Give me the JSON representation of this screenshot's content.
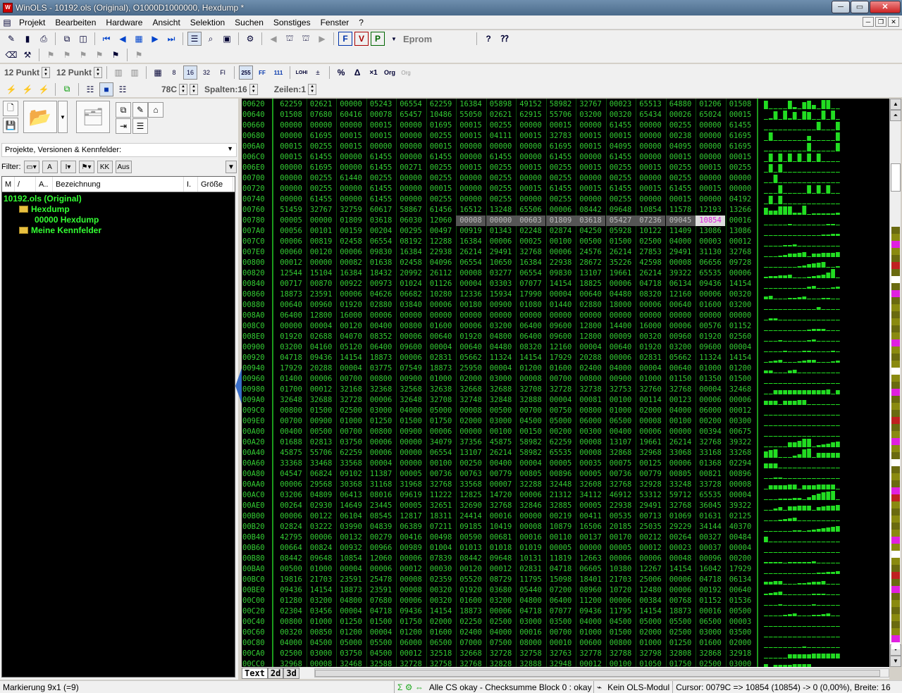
{
  "window": {
    "title": "WinOLS - 10192.ols (Original), O1000D1000000, Hexdump *",
    "controls": [
      "─",
      "▭",
      "✕"
    ]
  },
  "menu": [
    "Projekt",
    "Bearbeiten",
    "Hardware",
    "Ansicht",
    "Selektion",
    "Suchen",
    "Sonstiges",
    "Fenster",
    "?"
  ],
  "toolbar1": {
    "eprom_label": "Eprom"
  },
  "toolbar3": {
    "font_size_1": "12 Punkt",
    "font_size_2": "12 Punkt"
  },
  "toolbar4": {
    "offset": "78C",
    "columns": "Spalten:16",
    "rows": "Zeilen:1"
  },
  "left_panel": {
    "project_select": "Projekte, Versionen & Kennfelder:",
    "filter_label": "Filter:",
    "filter_aus": "Aus",
    "columns": [
      "M",
      "/",
      "A..",
      "Bezeichnung",
      "I.",
      "Größe"
    ],
    "tree": [
      {
        "text": "10192.ols (Original)",
        "indent": 0,
        "folder": false
      },
      {
        "text": "Hexdump",
        "indent": 1,
        "folder": true
      },
      {
        "text": "00000    Hexdump",
        "indent": 2,
        "folder": false
      },
      {
        "text": "Meine Kennfelder",
        "indent": 1,
        "folder": true
      }
    ]
  },
  "hexdump": {
    "addresses": [
      "00620",
      "00640",
      "00660",
      "00680",
      "006A0",
      "006C0",
      "006E0",
      "00700",
      "00720",
      "00740",
      "00760",
      "00780",
      "007A0",
      "007C0",
      "007E0",
      "00800",
      "00820",
      "00840",
      "00860",
      "00880",
      "008A0",
      "008C0",
      "008E0",
      "00900",
      "00920",
      "00940",
      "00960",
      "00980",
      "009A0",
      "009C0",
      "009E0",
      "00A00",
      "00A20",
      "00A40",
      "00A60",
      "00A80",
      "00AA0",
      "00AC0",
      "00AE0",
      "00B00",
      "00B20",
      "00B40",
      "00B60",
      "00B80",
      "00BA0",
      "00BC0",
      "00BE0",
      "00C00",
      "00C20",
      "00C40",
      "00C60",
      "00C80",
      "00CA0",
      "00CC0"
    ],
    "rows": [
      [
        "62259",
        "02621",
        "00000",
        "05243",
        "06554",
        "62259",
        "16384",
        "05898",
        "49152",
        "58982",
        "32767",
        "00023",
        "65513",
        "64880",
        "01206",
        "01508"
      ],
      [
        "01508",
        "07680",
        "60416",
        "00078",
        "65457",
        "10486",
        "55050",
        "02621",
        "62915",
        "55706",
        "03200",
        "00320",
        "65434",
        "00026",
        "65024",
        "00015"
      ],
      [
        "00000",
        "00000",
        "00000",
        "00015",
        "00000",
        "01695",
        "00015",
        "00255",
        "00000",
        "00015",
        "00000",
        "61455",
        "00000",
        "00255",
        "00000",
        "61455"
      ],
      [
        "00000",
        "61695",
        "00015",
        "00015",
        "00000",
        "00255",
        "00015",
        "04111",
        "00015",
        "32783",
        "00015",
        "00015",
        "00000",
        "00238",
        "00000",
        "61695"
      ],
      [
        "00015",
        "00255",
        "00015",
        "00000",
        "00000",
        "00015",
        "00000",
        "00000",
        "00000",
        "61695",
        "00015",
        "04095",
        "00000",
        "04095",
        "00000",
        "61695"
      ],
      [
        "00015",
        "61455",
        "00000",
        "61455",
        "00000",
        "61455",
        "00000",
        "61455",
        "00000",
        "61455",
        "00000",
        "61455",
        "00000",
        "00015",
        "00000",
        "00015"
      ],
      [
        "00000",
        "61695",
        "00000",
        "61455",
        "00271",
        "00255",
        "00015",
        "00255",
        "00015",
        "00255",
        "00015",
        "00255",
        "00015",
        "00255",
        "00015",
        "00255"
      ],
      [
        "00000",
        "00255",
        "61440",
        "00255",
        "00000",
        "00255",
        "00000",
        "00255",
        "00000",
        "00255",
        "00000",
        "00255",
        "00000",
        "00255",
        "00000",
        "00000"
      ],
      [
        "00000",
        "00255",
        "00000",
        "61455",
        "00000",
        "00015",
        "00000",
        "00255",
        "00015",
        "61455",
        "00015",
        "61455",
        "00015",
        "61455",
        "00015",
        "00000"
      ],
      [
        "00000",
        "61455",
        "00000",
        "61455",
        "00000",
        "00255",
        "00000",
        "00255",
        "00000",
        "00255",
        "00000",
        "00255",
        "00000",
        "00015",
        "00000",
        "04192"
      ],
      [
        "51459",
        "32767",
        "32759",
        "60617",
        "58867",
        "61456",
        "16512",
        "13248",
        "65506",
        "00006",
        "08442",
        "09648",
        "10854",
        "11578",
        "12193",
        "13266"
      ],
      [
        "00005",
        "00000",
        "01809",
        "03618",
        "06030",
        "12060",
        "00008",
        "00000",
        "00603",
        "01809",
        "03618",
        "05427",
        "07236",
        "09045",
        "10854",
        "00016"
      ],
      [
        "00056",
        "00101",
        "00159",
        "00204",
        "00295",
        "00497",
        "00919",
        "01343",
        "02248",
        "02874",
        "04250",
        "05928",
        "10122",
        "11409",
        "13086",
        "13086"
      ],
      [
        "00006",
        "00819",
        "02458",
        "06554",
        "08192",
        "12288",
        "16384",
        "00006",
        "00025",
        "00100",
        "00500",
        "01500",
        "02500",
        "04000",
        "00003",
        "00012"
      ],
      [
        "00060",
        "00120",
        "00006",
        "09830",
        "16384",
        "22938",
        "26214",
        "29491",
        "32768",
        "00006",
        "24576",
        "26214",
        "27853",
        "29491",
        "31130",
        "32768"
      ],
      [
        "00012",
        "00000",
        "00082",
        "01638",
        "02458",
        "04096",
        "06554",
        "10650",
        "16384",
        "22938",
        "28672",
        "35226",
        "42598",
        "00008",
        "06656",
        "09728"
      ],
      [
        "12544",
        "15104",
        "16384",
        "18432",
        "20992",
        "26112",
        "00008",
        "03277",
        "06554",
        "09830",
        "13107",
        "19661",
        "26214",
        "39322",
        "65535",
        "00006"
      ],
      [
        "00717",
        "00870",
        "00922",
        "00973",
        "01024",
        "01126",
        "00004",
        "03303",
        "07077",
        "14154",
        "18825",
        "00006",
        "04718",
        "06134",
        "09436",
        "14154"
      ],
      [
        "18873",
        "23591",
        "00006",
        "04626",
        "06682",
        "10280",
        "12336",
        "15934",
        "17990",
        "00004",
        "00640",
        "04480",
        "08320",
        "12160",
        "00006",
        "00320"
      ],
      [
        "00640",
        "00960",
        "01920",
        "02880",
        "03840",
        "00006",
        "00180",
        "00900",
        "01080",
        "01440",
        "02880",
        "18000",
        "00006",
        "00640",
        "01600",
        "03200"
      ],
      [
        "06400",
        "12800",
        "16000",
        "00006",
        "00000",
        "00000",
        "00000",
        "00000",
        "00000",
        "00000",
        "00000",
        "00000",
        "00000",
        "00000",
        "00000",
        "00000"
      ],
      [
        "00000",
        "00004",
        "00120",
        "00400",
        "00800",
        "01600",
        "00006",
        "03200",
        "06400",
        "09600",
        "12800",
        "14400",
        "16000",
        "00006",
        "00576",
        "01152"
      ],
      [
        "01920",
        "02688",
        "04070",
        "08352",
        "00006",
        "00640",
        "01920",
        "04800",
        "06400",
        "09600",
        "12800",
        "00009",
        "00320",
        "00960",
        "01920",
        "02560"
      ],
      [
        "03200",
        "04160",
        "05120",
        "06400",
        "09600",
        "00004",
        "00640",
        "04480",
        "08320",
        "12160",
        "00004",
        "00640",
        "01920",
        "03200",
        "09600",
        "00004"
      ],
      [
        "04718",
        "09436",
        "14154",
        "18873",
        "00006",
        "02831",
        "05662",
        "11324",
        "14154",
        "17929",
        "20288",
        "00006",
        "02831",
        "05662",
        "11324",
        "14154"
      ],
      [
        "17929",
        "20288",
        "00004",
        "03775",
        "07549",
        "18873",
        "25950",
        "00004",
        "01200",
        "01600",
        "02400",
        "04000",
        "00004",
        "00640",
        "01000",
        "01200"
      ],
      [
        "01400",
        "00006",
        "00700",
        "00800",
        "00900",
        "01000",
        "02000",
        "03000",
        "00008",
        "00700",
        "00800",
        "00900",
        "01000",
        "01150",
        "01350",
        "01500"
      ],
      [
        "01700",
        "00012",
        "32168",
        "32368",
        "32568",
        "32638",
        "32668",
        "32688",
        "32708",
        "32728",
        "32738",
        "32753",
        "32760",
        "32768",
        "00004",
        "32468"
      ],
      [
        "32648",
        "32688",
        "32728",
        "00006",
        "32648",
        "32708",
        "32748",
        "32848",
        "32888",
        "00004",
        "00081",
        "00100",
        "00114",
        "00123",
        "00006",
        "00006"
      ],
      [
        "00800",
        "01500",
        "02500",
        "03000",
        "04000",
        "05000",
        "00008",
        "00500",
        "00700",
        "00750",
        "00800",
        "01000",
        "02000",
        "04000",
        "06000",
        "00012"
      ],
      [
        "00700",
        "00900",
        "01000",
        "01250",
        "01500",
        "01750",
        "02000",
        "03000",
        "04500",
        "05000",
        "06000",
        "06500",
        "00008",
        "00100",
        "00200",
        "00300"
      ],
      [
        "00400",
        "00500",
        "00700",
        "00800",
        "00900",
        "00006",
        "00000",
        "00100",
        "00150",
        "00200",
        "00300",
        "00400",
        "00006",
        "00000",
        "00394",
        "00675"
      ],
      [
        "01688",
        "02813",
        "03750",
        "00006",
        "00000",
        "34079",
        "37356",
        "45875",
        "58982",
        "62259",
        "00008",
        "13107",
        "19661",
        "26214",
        "32768",
        "39322"
      ],
      [
        "45875",
        "55706",
        "62259",
        "00006",
        "00000",
        "06554",
        "13107",
        "26214",
        "58982",
        "65535",
        "00008",
        "32868",
        "32968",
        "33068",
        "33168",
        "33268"
      ],
      [
        "33368",
        "33468",
        "33568",
        "00004",
        "00000",
        "00100",
        "00250",
        "00400",
        "00004",
        "00005",
        "00035",
        "00075",
        "00125",
        "00006",
        "01368",
        "02294"
      ],
      [
        "04547",
        "06824",
        "09102",
        "11387",
        "00005",
        "00736",
        "00763",
        "00779",
        "00805",
        "00896",
        "00005",
        "00736",
        "00779",
        "00805",
        "00821",
        "00896"
      ],
      [
        "00006",
        "29568",
        "30368",
        "31168",
        "31968",
        "32768",
        "33568",
        "00007",
        "32288",
        "32448",
        "32608",
        "32768",
        "32928",
        "33248",
        "33728",
        "00008"
      ],
      [
        "03206",
        "04809",
        "06413",
        "08016",
        "09619",
        "11222",
        "12825",
        "14720",
        "00006",
        "21312",
        "34112",
        "46912",
        "53312",
        "59712",
        "65535",
        "00004"
      ],
      [
        "00264",
        "02930",
        "14649",
        "23445",
        "00005",
        "32651",
        "32690",
        "32768",
        "32846",
        "32885",
        "00005",
        "22938",
        "29491",
        "32768",
        "36045",
        "39322"
      ],
      [
        "00006",
        "00122",
        "06104",
        "08545",
        "12817",
        "18311",
        "24414",
        "00016",
        "00000",
        "00219",
        "00411",
        "00535",
        "00713",
        "01069",
        "01631",
        "02125"
      ],
      [
        "02824",
        "03222",
        "03990",
        "04839",
        "06389",
        "07211",
        "09185",
        "10419",
        "00008",
        "10879",
        "16506",
        "20185",
        "25035",
        "29229",
        "34144",
        "40370"
      ],
      [
        "42795",
        "00006",
        "00132",
        "00279",
        "00416",
        "00498",
        "00590",
        "00681",
        "00016",
        "00110",
        "00137",
        "00170",
        "00212",
        "00264",
        "00327",
        "00484"
      ],
      [
        "00664",
        "00824",
        "00932",
        "00966",
        "00989",
        "01004",
        "01013",
        "01018",
        "01019",
        "00005",
        "00000",
        "00005",
        "00012",
        "00023",
        "00037",
        "00004"
      ],
      [
        "08442",
        "09648",
        "10854",
        "12060",
        "00006",
        "07839",
        "08442",
        "09648",
        "10131",
        "11819",
        "12663",
        "00006",
        "00006",
        "00048",
        "00096",
        "00200"
      ],
      [
        "00500",
        "01000",
        "00004",
        "00006",
        "00012",
        "00030",
        "00120",
        "00012",
        "02831",
        "04718",
        "06605",
        "10380",
        "12267",
        "14154",
        "16042",
        "17929"
      ],
      [
        "19816",
        "21703",
        "23591",
        "25478",
        "00008",
        "02359",
        "05520",
        "08729",
        "11795",
        "15098",
        "18401",
        "21703",
        "25006",
        "00006",
        "04718",
        "06134"
      ],
      [
        "09436",
        "14154",
        "18873",
        "23591",
        "00008",
        "00320",
        "01920",
        "03680",
        "05440",
        "07200",
        "08960",
        "10720",
        "12480",
        "00006",
        "00192",
        "00640"
      ],
      [
        "01280",
        "03200",
        "04800",
        "07680",
        "00006",
        "00320",
        "01600",
        "03200",
        "04800",
        "06400",
        "11200",
        "00006",
        "00384",
        "00768",
        "01152",
        "01536"
      ],
      [
        "02304",
        "03456",
        "00004",
        "04718",
        "09436",
        "14154",
        "18873",
        "00006",
        "04718",
        "07077",
        "09436",
        "11795",
        "14154",
        "18873",
        "00016",
        "00500"
      ],
      [
        "00800",
        "01000",
        "01250",
        "01500",
        "01750",
        "02000",
        "02250",
        "02500",
        "03000",
        "03500",
        "04000",
        "04500",
        "05000",
        "05500",
        "06500",
        "00003"
      ],
      [
        "00320",
        "00850",
        "01200",
        "00004",
        "01200",
        "01600",
        "02400",
        "04000",
        "00016",
        "00700",
        "01000",
        "01500",
        "02000",
        "02500",
        "03000",
        "03500"
      ],
      [
        "04000",
        "04500",
        "05000",
        "05500",
        "06000",
        "06500",
        "07000",
        "07500",
        "08000",
        "00010",
        "00600",
        "00800",
        "01000",
        "01250",
        "01600",
        "02000"
      ],
      [
        "02500",
        "03000",
        "03750",
        "04500",
        "00012",
        "32518",
        "32668",
        "32728",
        "32758",
        "32763",
        "32778",
        "32788",
        "32798",
        "32808",
        "32868",
        "32918"
      ],
      [
        "32968",
        "00008",
        "32468",
        "32588",
        "32728",
        "32758",
        "32768",
        "32828",
        "32888",
        "32948",
        "00012",
        "00100",
        "01050",
        "01750",
        "02500",
        "03000"
      ]
    ],
    "selection": {
      "row": 11,
      "from": 6,
      "to": 13,
      "cursor": 14
    }
  },
  "bottom_tabs": [
    "Text",
    "2d",
    "3d"
  ],
  "statusbar": {
    "markierung": "Markierung 9x1 (=9)",
    "checksum": "Alle CS okay - Checksumme Block 0 : okay",
    "ols_module": "Kein OLS-Modul",
    "cursor": "Cursor: 0079C => 10854 (10854) -> 0 (0,00%), Breite: 16"
  },
  "colors": {
    "hex_text": "#33cc33",
    "hex_bg": "#000000",
    "graph_bar": "#22dd22",
    "tree_text": "#33ff33",
    "cursor_text": "#dd22dd"
  },
  "icons": [
    "new-icon",
    "open-folder-icon",
    "save-icon",
    "print-icon",
    "first-icon",
    "prev-icon",
    "grid-icon",
    "next-icon",
    "last-icon",
    "percent-icon",
    "delta-icon",
    "help-icon"
  ]
}
